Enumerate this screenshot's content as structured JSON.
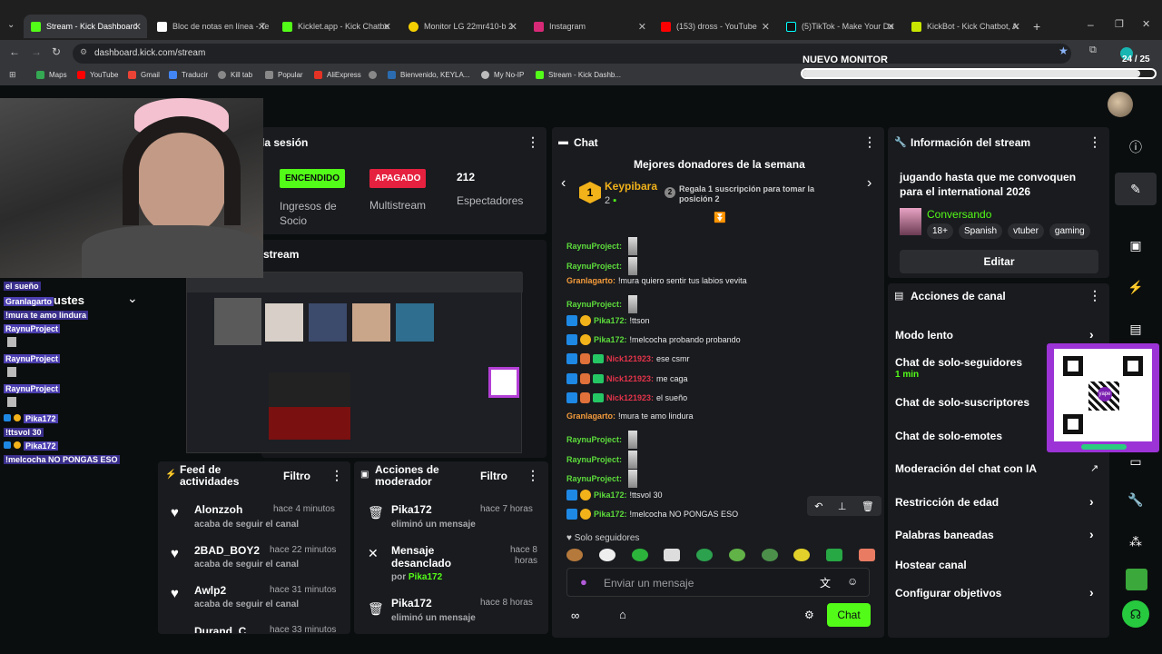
{
  "browser": {
    "tabs": [
      {
        "label": "Stream - Kick Dashboard",
        "active": true
      },
      {
        "label": "Bloc de notas en línea - Te"
      },
      {
        "label": "Kicklet.app - Kick Chatbo"
      },
      {
        "label": "Monitor LG 22mr410-b 2"
      },
      {
        "label": "Instagram"
      },
      {
        "label": "(153) dross - YouTube"
      },
      {
        "label": "(5)TikTok - Make Your Da"
      },
      {
        "label": "KickBot - Kick Chatbot, A"
      }
    ],
    "url": "dashboard.kick.com/stream",
    "bookmarks": [
      "Maps",
      "YouTube",
      "Gmail",
      "Traducir",
      "Kill tab",
      "Popular",
      "AliExpress",
      "Bienvenido, KEYLA...",
      "My No-IP",
      "Stream - Kick Dashb..."
    ],
    "goal": {
      "label": "NUEVO MONITOR",
      "count": "24",
      "total": "/ 25",
      "progress": 0.96
    }
  },
  "session_panel": {
    "title": "la sesión",
    "encendido": "ENCENDIDO",
    "apagado": "APAGADO",
    "viewers": "212",
    "ingresos_label": "Ingresos de Socio",
    "multistream_label": "Multistream",
    "espectadores_label": "Espectadores",
    "stream_label": "stream"
  },
  "overlay_chat": {
    "lines": [
      {
        "text": "el sueño"
      },
      {
        "name": "Granlagarto",
        "text": "!mura te amo lindura"
      },
      {
        "name": "RaynuProject"
      },
      {
        "name": "RaynuProject"
      },
      {
        "name": "RaynuProject"
      },
      {
        "name": "Pika172",
        "text": "!ttsvol 30"
      },
      {
        "name": "Pika172",
        "text": "!melcocha NO PONGAS ESO"
      }
    ],
    "ustes": "ustes"
  },
  "feed": {
    "title": "Feed de actividades",
    "filter": "Filtro",
    "items": [
      {
        "name": "Alonzzoh",
        "time": "hace 4 minutos",
        "sub": "acaba de seguir el canal"
      },
      {
        "name": "2BAD_BOY2",
        "time": "hace 22 minutos",
        "sub": "acaba de seguir el canal"
      },
      {
        "name": "Awlp2",
        "time": "hace 31 minutos",
        "sub": "acaba de seguir el canal"
      },
      {
        "name": "Durand_C",
        "time": "hace 33 minutos"
      }
    ]
  },
  "mod_actions": {
    "title": "Acciones de moderador",
    "filter": "Filtro",
    "items": [
      {
        "name": "Pika172",
        "time": "hace 7 horas",
        "sub": "eliminó un mensaje"
      },
      {
        "name": "Mensaje desanclado",
        "time": "hace 8 horas",
        "sub_prefix": "por",
        "sub_user": "Pika172"
      },
      {
        "name": "Pika172",
        "time": "hace 8 horas",
        "sub": "eliminó un mensaje"
      }
    ]
  },
  "chat": {
    "title": "Chat",
    "top_donors_title": "Mejores donadores de la semana",
    "donor_rank": "1",
    "donor_name": "Keypibara",
    "donor_count": "2",
    "next_rank": "2",
    "next_text": "Regala 1 suscripción para tomar la posición 2",
    "messages": [
      {
        "user": "RaynuProject:",
        "text": "",
        "emote": true,
        "color": "#5ddc3b"
      },
      {
        "user": "RaynuProject:",
        "text": "",
        "emote": true,
        "color": "#5ddc3b"
      },
      {
        "user": "Granlagarto:",
        "text": "!mura quiero sentir tus labios vevita",
        "color": "#f49b3b"
      },
      {
        "user": "RaynuProject:",
        "text": "",
        "emote": true,
        "color": "#5ddc3b"
      },
      {
        "user": "Pika172:",
        "text": "!ttson",
        "color": "#5ddc3b",
        "badges": "bo"
      },
      {
        "user": "Pika172:",
        "text": "!melcocha probando probando",
        "color": "#5ddc3b",
        "badges": "bo"
      },
      {
        "user": "Nick121923:",
        "text": "ese csmr",
        "color": "#e4344a",
        "badges": "bsg"
      },
      {
        "user": "Nick121923:",
        "text": "me caga",
        "color": "#e4344a",
        "badges": "bsg"
      },
      {
        "user": "Nick121923:",
        "text": "el sueño",
        "color": "#e4344a",
        "badges": "bsg"
      },
      {
        "user": "Granlagarto:",
        "text": "!mura te amo lindura",
        "color": "#f49b3b"
      },
      {
        "user": "RaynuProject:",
        "text": "",
        "emote": true,
        "color": "#5ddc3b"
      },
      {
        "user": "RaynuProject:",
        "text": "",
        "emote": true,
        "color": "#5ddc3b"
      },
      {
        "user": "RaynuProject:",
        "text": "",
        "emote": true,
        "color": "#5ddc3b"
      },
      {
        "user": "Pika172:",
        "text": "!ttsvol 30",
        "color": "#5ddc3b",
        "badges": "bo"
      },
      {
        "user": "Pika172:",
        "text": "!melcocha NO PONGAS ESO",
        "color": "#5ddc3b",
        "badges": "bo"
      }
    ],
    "followers_only": "Solo seguidores",
    "input_placeholder": "Enviar un mensaje",
    "send_label": "Chat"
  },
  "stream_info": {
    "title": "Información del stream",
    "stream_title": "jugando hasta que me convoquen para el international 2026",
    "category": "Conversando",
    "tags": [
      "18+",
      "Spanish",
      "vtuber",
      "gaming"
    ],
    "edit_label": "Editar"
  },
  "channel_actions": {
    "title": "Acciones de canal",
    "items": [
      {
        "label": "Modo lento",
        "chevron": true
      },
      {
        "label": "Chat de solo-seguidores",
        "sub": "1 min"
      },
      {
        "label": "Chat de solo-suscriptores"
      },
      {
        "label": "Chat de solo-emotes"
      },
      {
        "label": "Moderación del chat con IA",
        "external": true
      },
      {
        "label": "Restricción de edad",
        "chevron": true
      },
      {
        "label": "Palabras baneadas",
        "chevron": true
      },
      {
        "label": "Hostear canal"
      },
      {
        "label": "Configurar objetivos",
        "chevron": true
      }
    ]
  },
  "qr": {
    "brand": "yape"
  },
  "colors": {
    "kick_green": "#53fc18",
    "panel": "#191b1f",
    "bg": "#0b0e0f",
    "accent_green": "#4ade1c"
  }
}
